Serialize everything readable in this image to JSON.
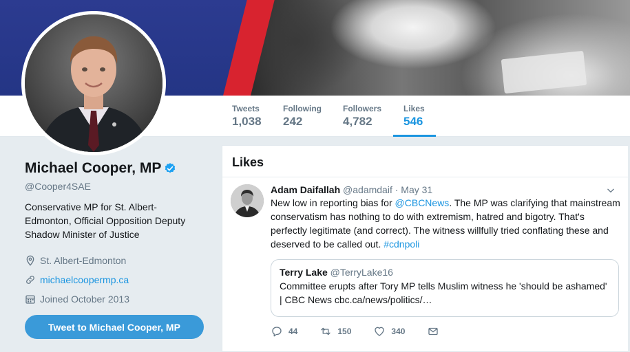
{
  "colors": {
    "accent": "#1b95e0",
    "button": "#3a9ad9",
    "muted": "#657786",
    "banner_red": "#d8232f",
    "banner_blue": "#2c3b90"
  },
  "nav": {
    "stats": [
      {
        "label": "Tweets",
        "value": "1,038"
      },
      {
        "label": "Following",
        "value": "242"
      },
      {
        "label": "Followers",
        "value": "4,782"
      },
      {
        "label": "Likes",
        "value": "546",
        "active": true
      }
    ]
  },
  "profile": {
    "name": "Michael Cooper, MP",
    "handle": "@Cooper4SAE",
    "bio": "Conservative MP for St. Albert-Edmonton, Official Opposition Deputy Shadow Minister of Justice",
    "location": "St. Albert-Edmonton",
    "website": "michaelcoopermp.ca",
    "joined": "Joined October 2013",
    "tweet_to_label": "Tweet to Michael Cooper, MP",
    "icons": {
      "location": "location-pin-icon",
      "website": "link-icon",
      "joined": "calendar-icon",
      "verified": "verified-badge-icon"
    }
  },
  "timeline": {
    "title": "Likes",
    "tweet": {
      "author": "Adam Daifallah",
      "handle": "@adamdaif",
      "date": "· May 31",
      "text_parts": [
        "New low in reporting bias for ",
        "@CBCNews",
        ". The MP was clarifying that mainstream conservatism has nothing to do with extremism, hatred and bigotry. That's perfectly legitimate (and correct). The witness willfully tried conflating these and deserved to be called out. ",
        "#cdnpoli"
      ],
      "quote": {
        "author": "Terry Lake",
        "handle": "@TerryLake16",
        "text": "Committee erupts after Tory MP tells Muslim witness he 'should be ashamed' | CBC News cbc.ca/news/politics/…"
      },
      "actions": {
        "replies": "44",
        "retweets": "150",
        "likes": "340"
      }
    }
  }
}
